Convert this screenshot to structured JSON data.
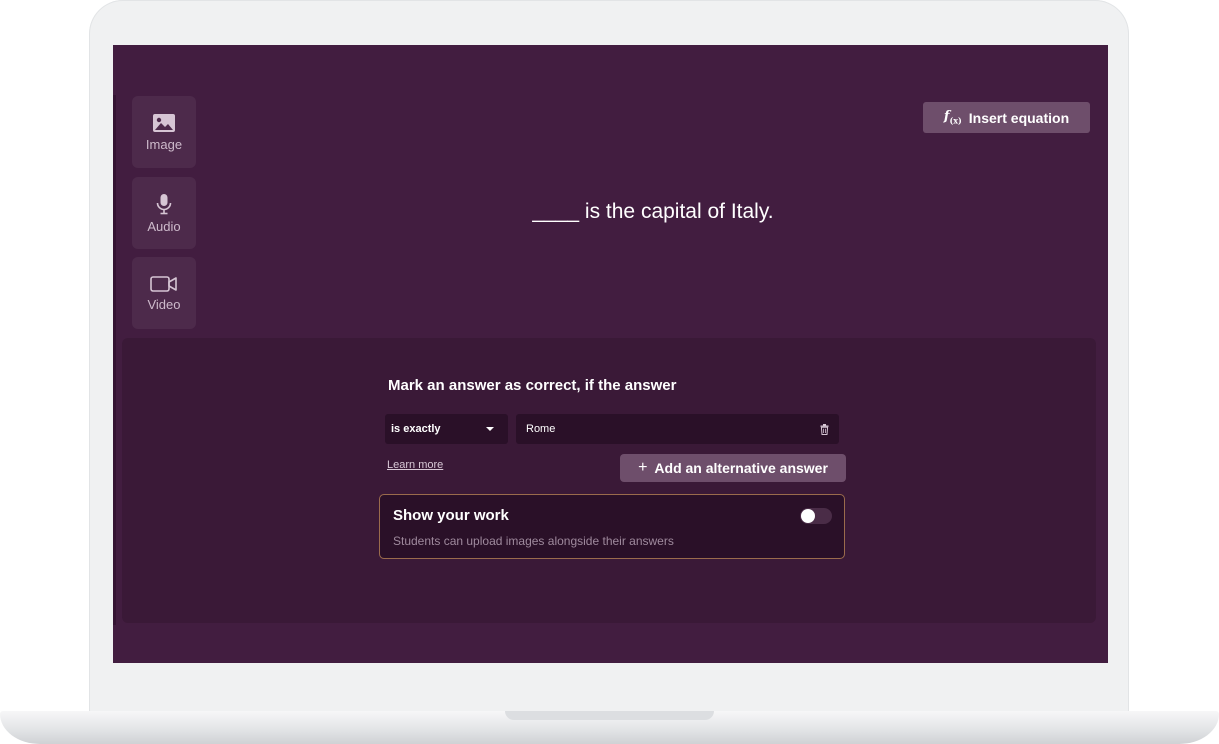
{
  "sidebar": {
    "items": [
      {
        "label": "Image",
        "icon": "image-icon"
      },
      {
        "label": "Audio",
        "icon": "microphone-icon"
      },
      {
        "label": "Video",
        "icon": "video-camera-icon"
      }
    ]
  },
  "toolbar": {
    "insert_equation_icon": "f(x)",
    "insert_equation_label": "Insert equation"
  },
  "question": {
    "text": "____ is the capital of Italy."
  },
  "answer_panel": {
    "title": "Mark an answer as correct, if the answer",
    "match_type": "is exactly",
    "answer_value": "Rome",
    "learn_more": "Learn more",
    "add_alternative_label": "Add an alternative answer",
    "add_alternative_icon": "+"
  },
  "show_your_work": {
    "title": "Show your work",
    "description": "Students can upload images alongside their answers",
    "enabled": false
  },
  "colors": {
    "screen_bg": "#421d40",
    "panel_bg": "#3a1937",
    "button_bg": "#6e4e6b",
    "field_bg": "#2a1028",
    "highlight_border": "#9a6b4c"
  }
}
